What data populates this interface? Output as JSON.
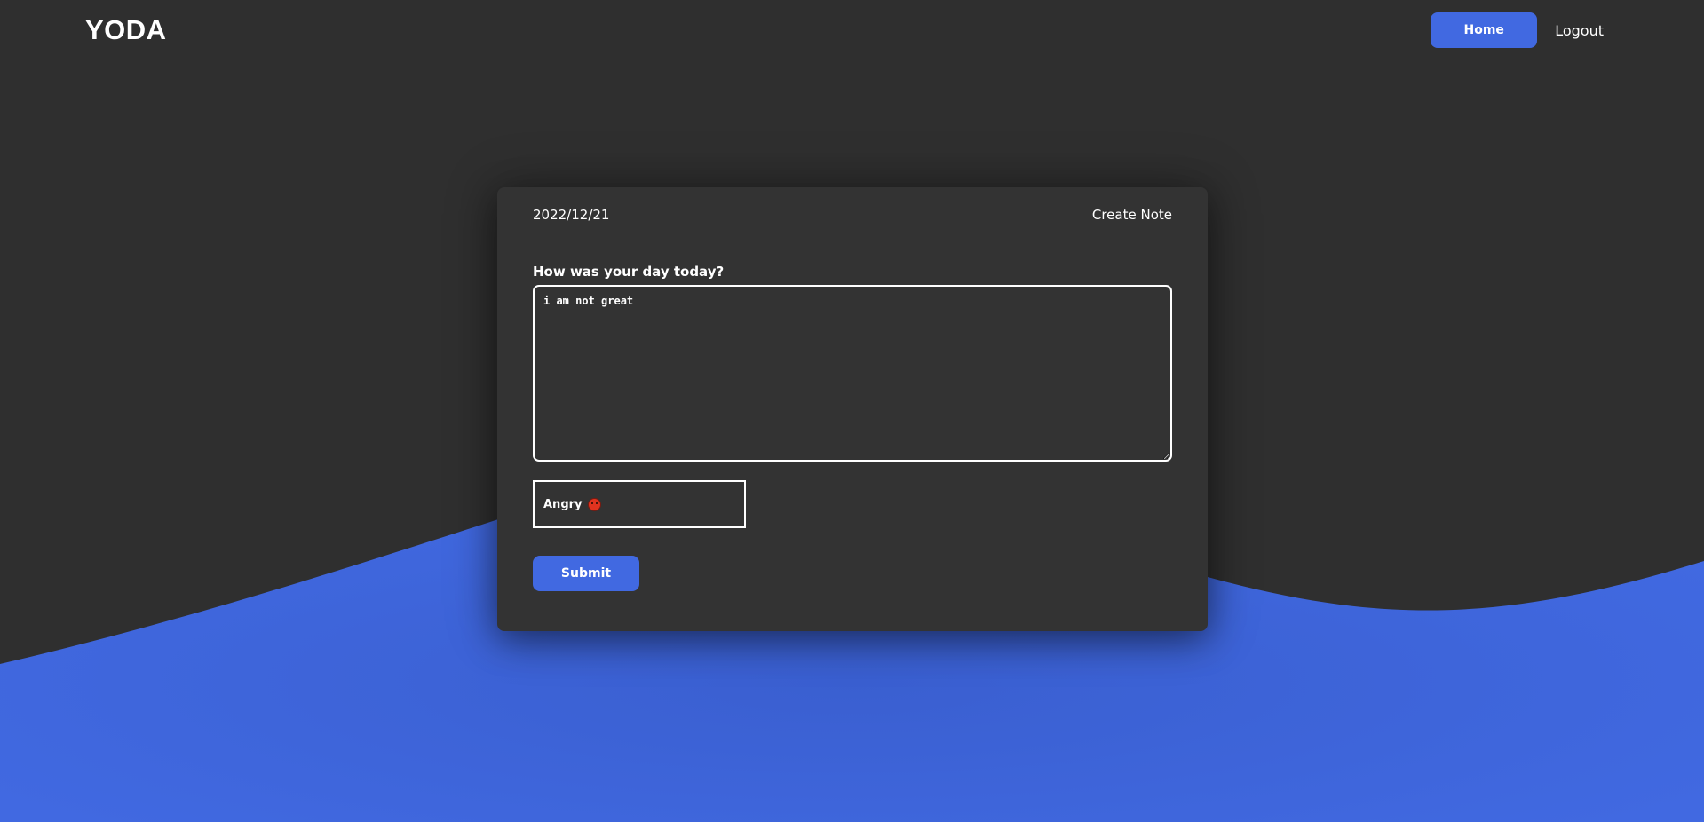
{
  "app": {
    "logo": "YODA"
  },
  "nav": {
    "home_label": "Home",
    "logout_label": "Logout"
  },
  "note_card": {
    "date": "2022/12/21",
    "title": "Create Note",
    "question": "How was your day today?",
    "textarea_value": "i am not great",
    "mood": {
      "selected": "Angry",
      "icon": "angry-face-icon"
    },
    "submit_label": "Submit"
  },
  "colors": {
    "background": "#2f2f2f",
    "card": "#333333",
    "accent": "#4169e1",
    "text": "#ffffff"
  }
}
